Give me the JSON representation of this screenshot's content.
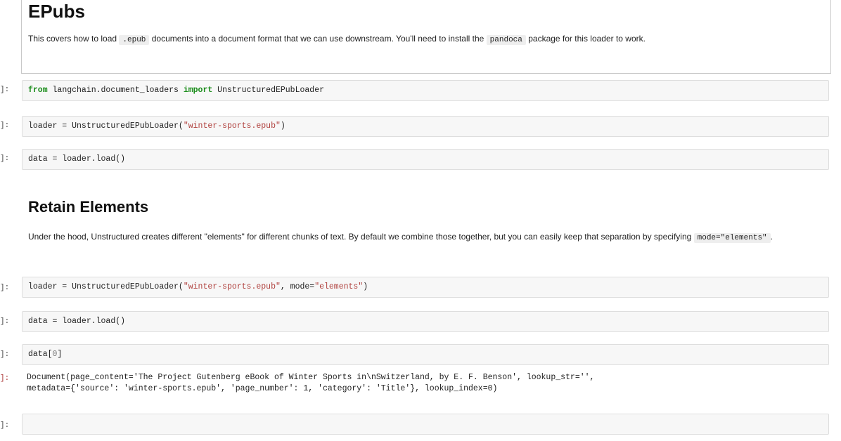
{
  "epubs": {
    "title": "EPubs",
    "para": {
      "t1": "This covers how to load ",
      "c1": ".epub",
      "t2": " documents into a document format that we can use downstream. You'll need to install the ",
      "c2": "pandoca",
      "t3": " package for this loader to work."
    }
  },
  "cells": [
    {
      "prompt": "]:",
      "code": {
        "kw_from": "from",
        "module": " langchain.document_loaders ",
        "kw_import": "import",
        "name": " UnstructuredEPubLoader"
      }
    },
    {
      "prompt": "]:",
      "code": {
        "pre": "loader = UnstructuredEPubLoader(",
        "str": "\"winter-sports.epub\"",
        "post": ")"
      }
    },
    {
      "prompt": "]:",
      "code": {
        "text": "data = loader.load()"
      }
    },
    {
      "prompt": "]:",
      "code": {
        "pre": "loader = UnstructuredEPubLoader(",
        "str1": "\"winter-sports.epub\"",
        "mid": ", mode=",
        "str2": "\"elements\"",
        "post": ")"
      }
    },
    {
      "prompt": "]:",
      "code": {
        "text": "data = loader.load()"
      }
    },
    {
      "prompt": "]:",
      "code": {
        "pre": "data[",
        "num": "0",
        "post": "]"
      }
    },
    {
      "prompt": "]:",
      "code": {
        "text": ""
      }
    }
  ],
  "retain": {
    "title": "Retain Elements",
    "para": {
      "t1": "Under the hood, Unstructured creates different \"elements\" for different chunks of text. By default we combine those together, but you can easily keep that separation by specifying ",
      "c1": "mode=\"elements\"",
      "t2": "."
    }
  },
  "output": {
    "prompt": "]:",
    "text": "Document(page_content='The Project Gutenberg eBook of Winter Sports in\\nSwitzerland, by E. F. Benson', lookup_str='',\nmetadata={'source': 'winter-sports.epub', 'page_number': 1, 'category': 'Title'}, lookup_index=0)"
  }
}
